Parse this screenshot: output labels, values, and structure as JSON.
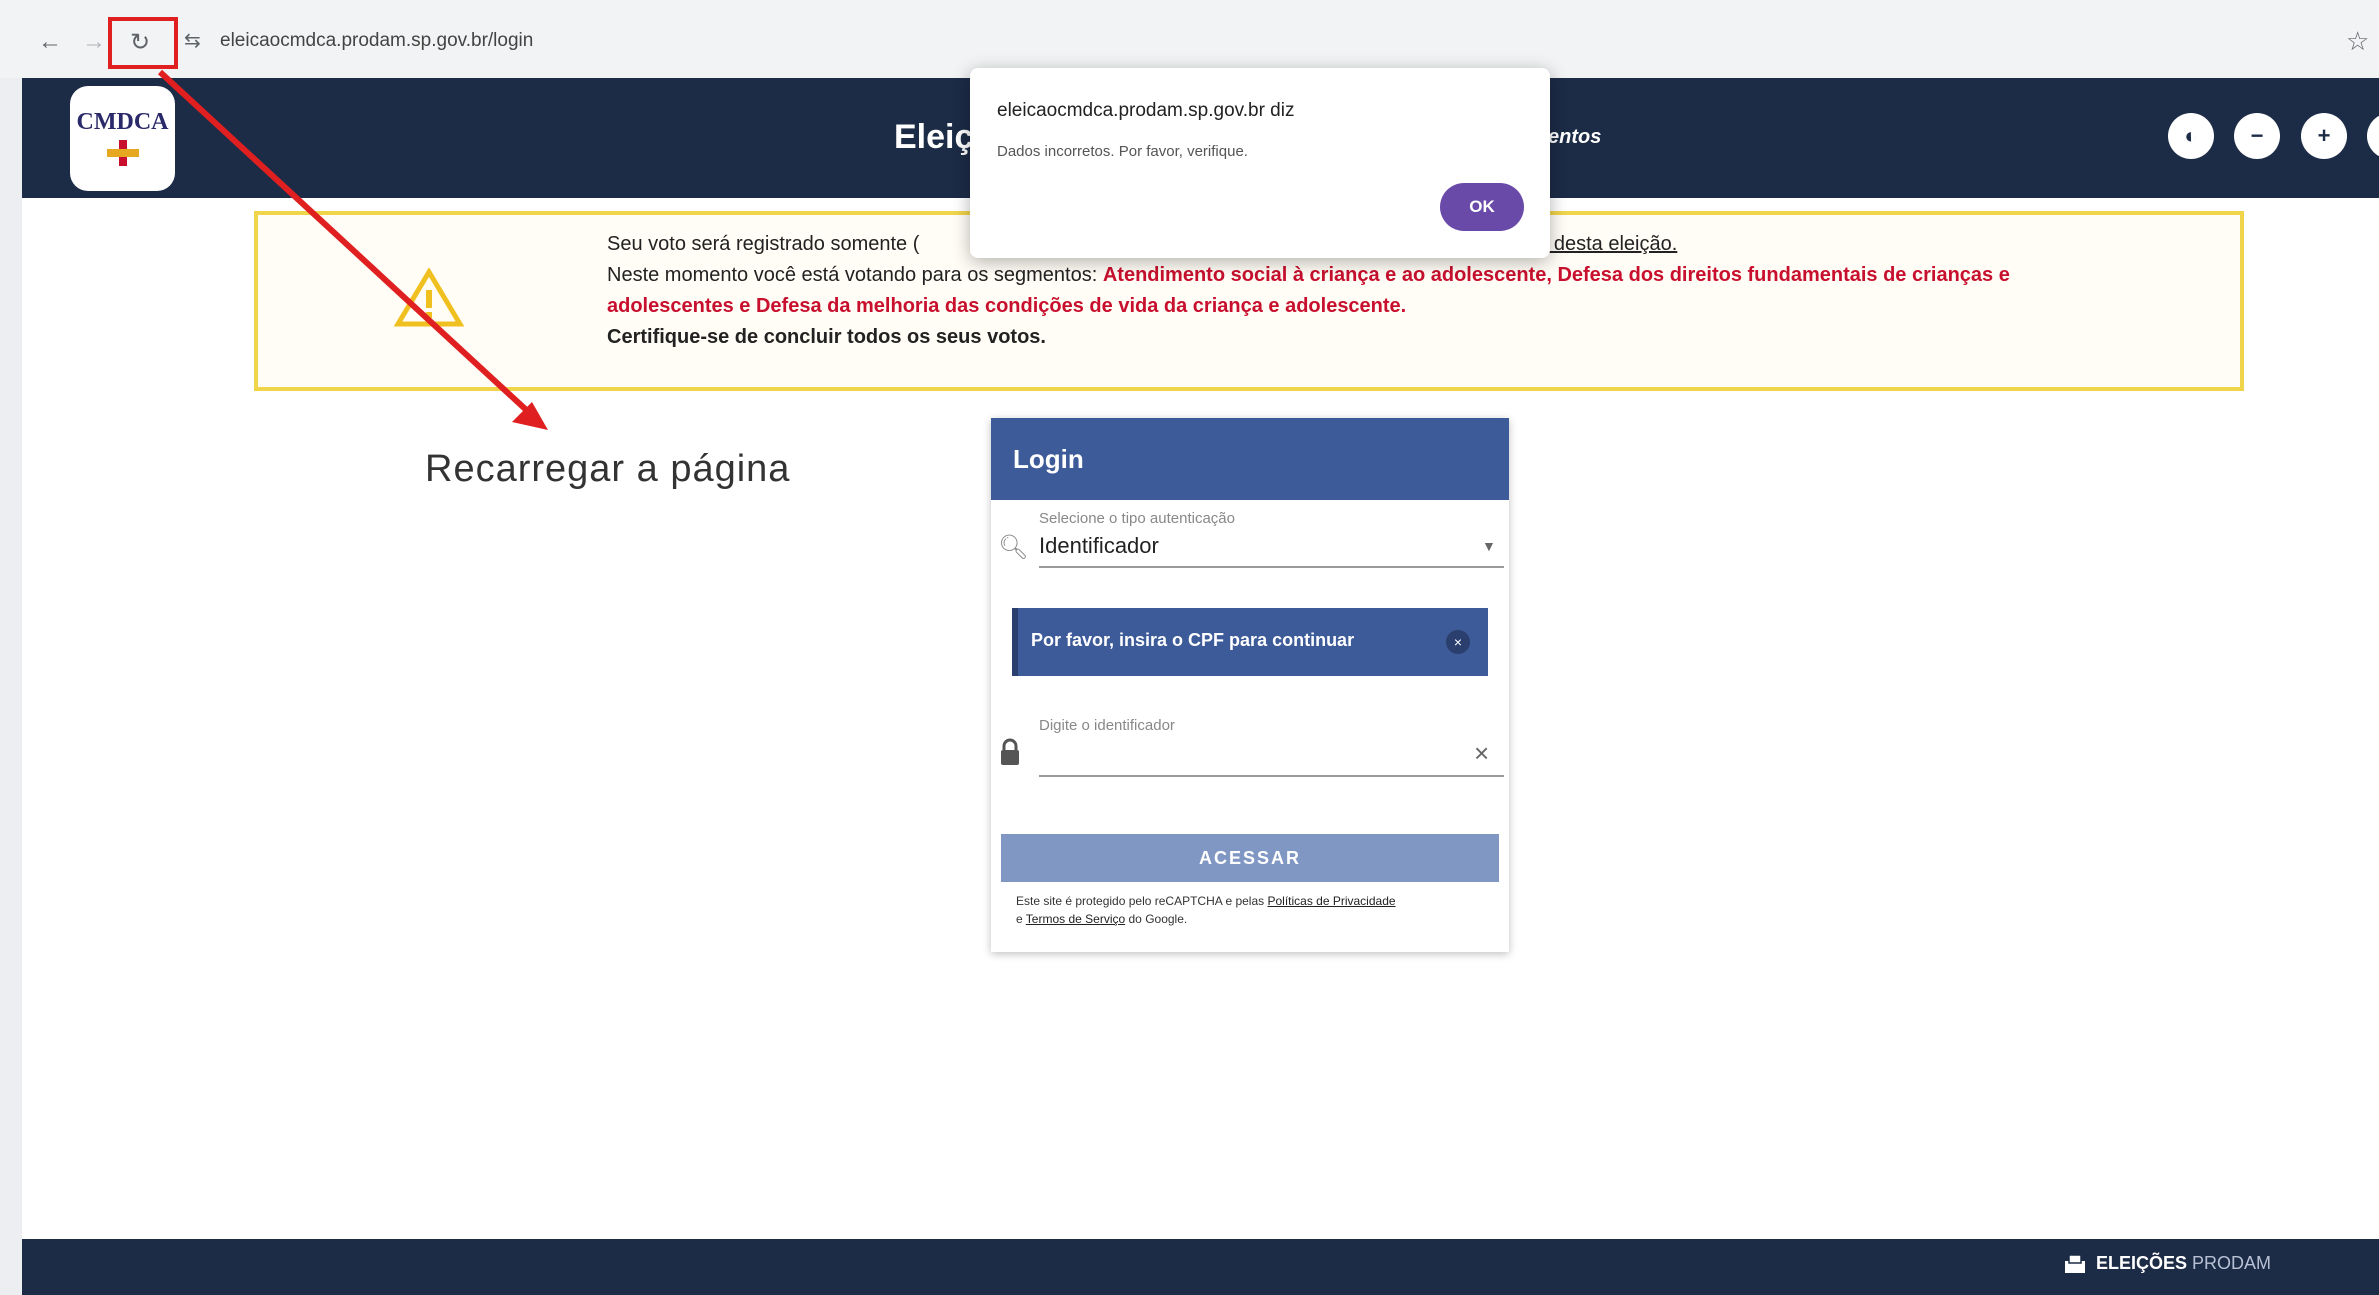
{
  "browser": {
    "url": "eleicaocmdca.prodam.sp.gov.br/login"
  },
  "header": {
    "logo_text": "CMDCA",
    "title_visible": "Eleiç",
    "title_tail": "entos"
  },
  "warning": {
    "line1_start": "Seu voto será registrado somente (",
    "line1_link": "entos desta eleição.",
    "line2_prefix": "Neste momento você está votando para os segmentos: ",
    "line2_red": "Atendimento social à criança e ao adolescente, Defesa dos direitos fundamentais de crianças e",
    "line3_red": "adolescentes e Defesa da melhoria das condições de vida da criança e adolescente.",
    "line4": "Certifique-se de concluir todos os seus votos."
  },
  "annotation": {
    "label": "Recarregar a página"
  },
  "login": {
    "title": "Login",
    "auth_label": "Selecione o tipo autenticação",
    "auth_value": "Identificador",
    "info_message": "Por favor, insira o CPF para continuar",
    "id_label": "Digite o identificador",
    "access_button": "ACESSAR",
    "recaptcha_text": "Este site é protegido pelo reCAPTCHA e pelas ",
    "privacy_link": "Políticas de Privacidade",
    "and_text": "e ",
    "terms_link": "Termos de Serviço",
    "google_text": " do Google."
  },
  "dialog": {
    "title": "eleicaocmdca.prodam.sp.gov.br diz",
    "message": "Dados incorretos. Por favor, verifique.",
    "ok_label": "OK"
  },
  "footer": {
    "brand_bold": "ELEIÇÕES",
    "brand_light": "PRODAM"
  },
  "colors": {
    "header_bg": "#1c2b46",
    "login_blue": "#3d5a99",
    "warning_border": "#f0d44a",
    "warning_red": "#c8102e",
    "annotation_red": "#e02020",
    "ok_purple": "#6a4aa8"
  },
  "icons": {
    "back": "arrow-left-icon",
    "forward": "arrow-right-icon",
    "reload": "reload-icon",
    "site_settings": "tune-icon",
    "bookmark": "star-icon",
    "warning": "warning-triangle-icon",
    "search": "search-icon",
    "lock": "lock-icon",
    "clear": "close-icon",
    "footer": "ballot-box-icon"
  }
}
